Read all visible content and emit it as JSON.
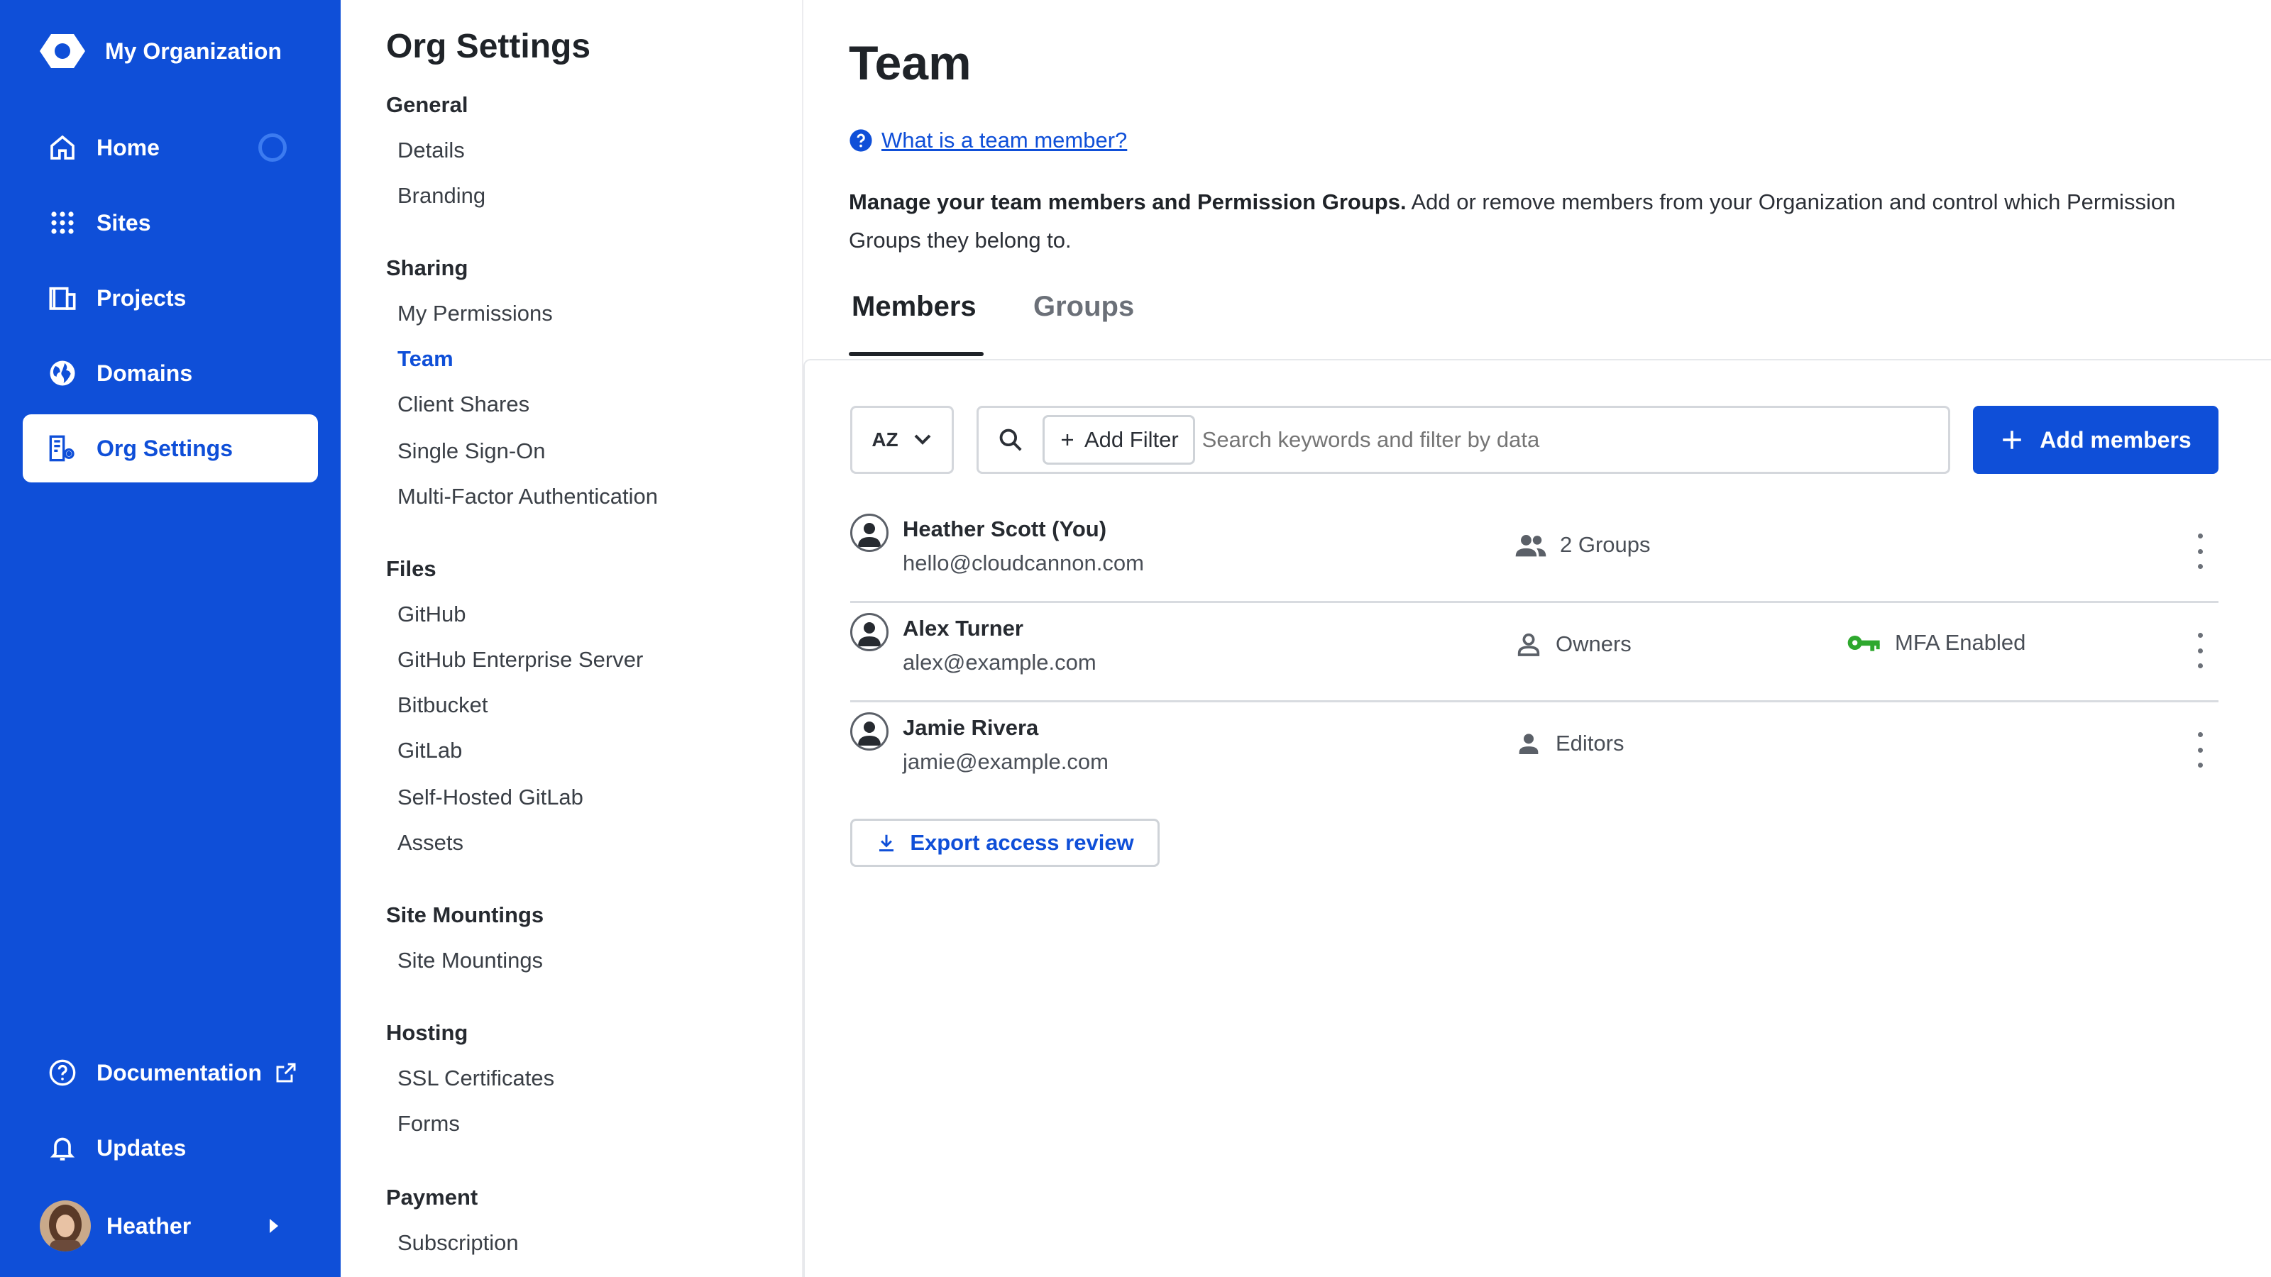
{
  "nav": {
    "org_name": "My Organization",
    "items": [
      {
        "label": "Home"
      },
      {
        "label": "Sites"
      },
      {
        "label": "Projects"
      },
      {
        "label": "Domains"
      },
      {
        "label": "Org Settings"
      }
    ],
    "documentation_label": "Documentation",
    "updates_label": "Updates",
    "user_name": "Heather",
    "accent_color": "#0f4fd8"
  },
  "settings": {
    "title": "Org Settings",
    "sections": [
      {
        "heading": "General",
        "items": [
          "Details",
          "Branding"
        ]
      },
      {
        "heading": "Sharing",
        "items": [
          "My Permissions",
          "Team",
          "Client Shares",
          "Single Sign-On",
          "Multi-Factor Authentication"
        ]
      },
      {
        "heading": "Files",
        "items": [
          "GitHub",
          "GitHub Enterprise Server",
          "Bitbucket",
          "GitLab",
          "Self-Hosted GitLab",
          "Assets"
        ]
      },
      {
        "heading": "Site Mountings",
        "items": [
          "Site Mountings"
        ]
      },
      {
        "heading": "Hosting",
        "items": [
          "SSL Certificates",
          "Forms"
        ]
      },
      {
        "heading": "Payment",
        "items": [
          "Subscription"
        ]
      }
    ],
    "active_item": "Team"
  },
  "main": {
    "title": "Team",
    "help_link": "What is a team member?",
    "intro_bold": "Manage your team members and Permission Groups.",
    "intro_rest": " Add or remove members from your Organization and control which Permission Groups they belong to.",
    "tabs": [
      {
        "label": "Members",
        "active": true
      },
      {
        "label": "Groups",
        "active": false
      }
    ],
    "sort_label": "AZ",
    "add_filter_label": "Add Filter",
    "search_placeholder": "Search keywords and filter by data",
    "add_members_label": "Add members",
    "members": [
      {
        "name": "Heather Scott (You)",
        "email": "hello@cloudcannon.com",
        "group": "2 Groups",
        "group_icon": "people-icon",
        "mfa": ""
      },
      {
        "name": "Alex Turner",
        "email": "alex@example.com",
        "group": "Owners",
        "group_icon": "person-outline-icon",
        "mfa": "MFA Enabled"
      },
      {
        "name": "Jamie Rivera",
        "email": "jamie@example.com",
        "group": "Editors",
        "group_icon": "person-filled-icon",
        "mfa": ""
      }
    ],
    "mfa_color": "#2ea82e",
    "export_label": "Export access review"
  }
}
